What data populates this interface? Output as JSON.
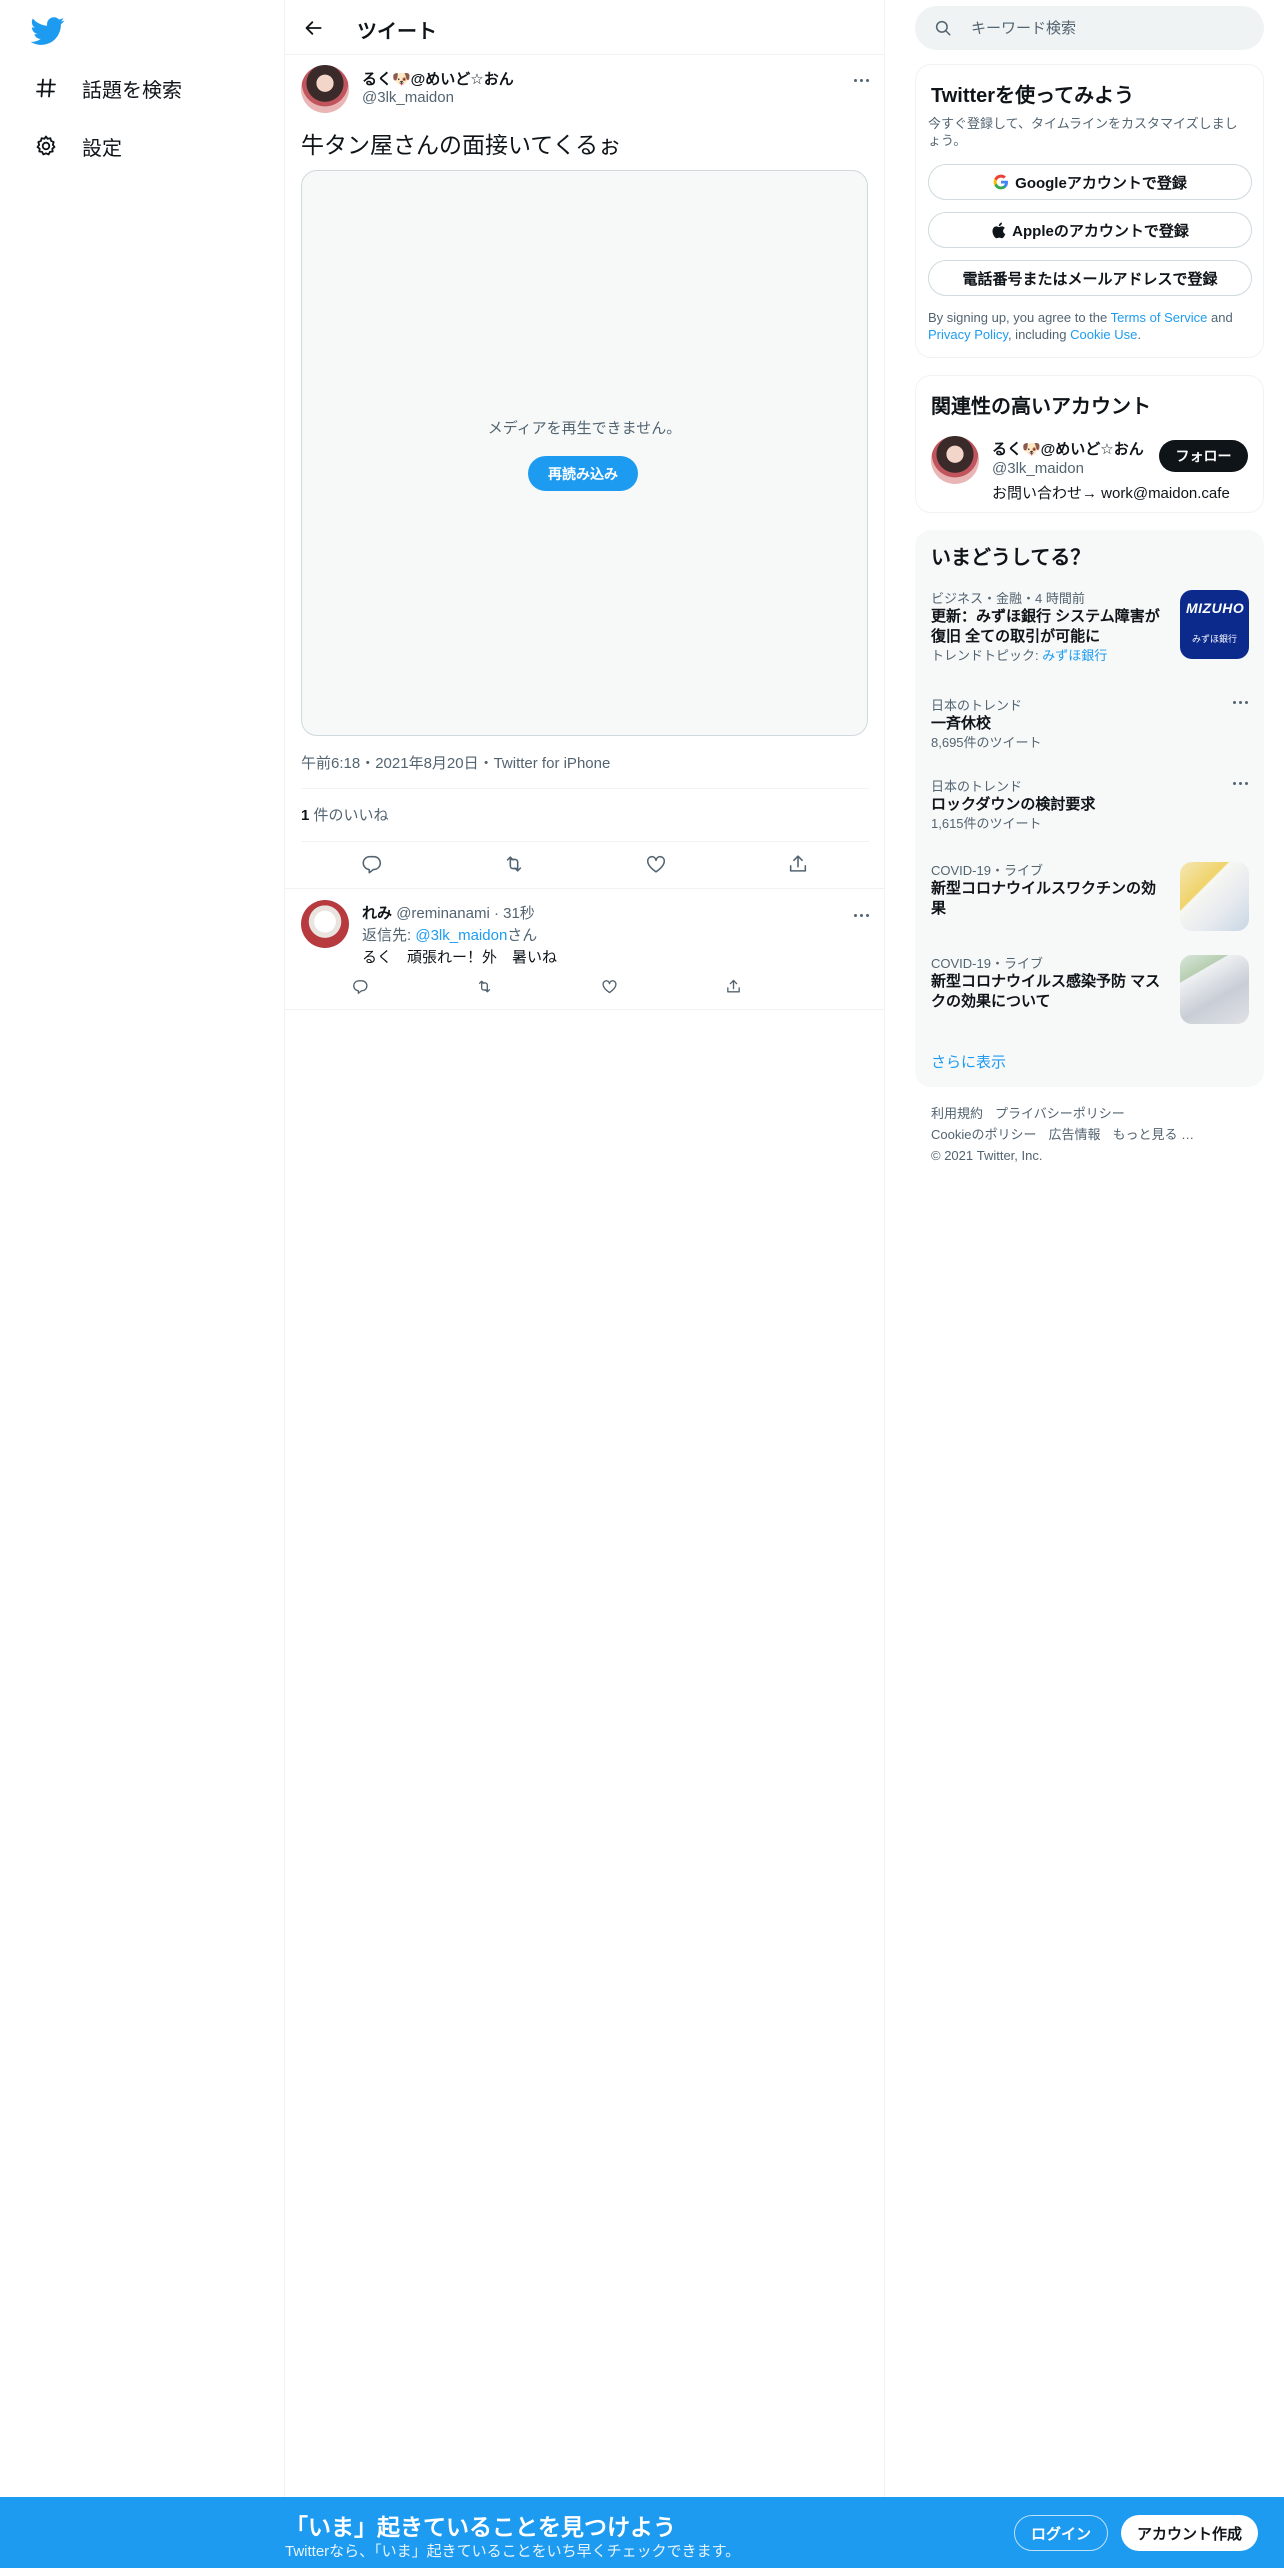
{
  "nav": {
    "logo_icon": "twitter-bird-icon",
    "explore_label": "話題を検索",
    "settings_label": "設定"
  },
  "header": {
    "title": "ツイート"
  },
  "tweet": {
    "author_name": "るく🐶@めいど☆おん",
    "author_handle": "@3lk_maidon",
    "text": "牛タン屋さんの面接いてくるぉ",
    "media_error": "メディアを再生できません。",
    "reload_label": "再読み込み",
    "meta": "午前6:18・2021年8月20日・Twitter for iPhone",
    "likes_count": "1",
    "likes_label": "件のいいね"
  },
  "reply": {
    "author_name": "れみ",
    "author_handle": "@reminanami",
    "time": "31秒",
    "reply_to_prefix": "返信先: ",
    "reply_to_handle": "@3lk_maidon",
    "reply_to_suffix": "さん",
    "text": "るく　頑張れー！外　暑いね"
  },
  "search": {
    "placeholder": "キーワード検索"
  },
  "signup": {
    "title": "Twitterを使ってみよう",
    "subtitle": "今すぐ登録して、タイムラインをカスタマイズしましょう。",
    "google_label": "Googleアカウントで登録",
    "apple_label": "Appleのアカウントで登録",
    "phone_label": "電話番号またはメールアドレスで登録",
    "terms_prefix": "By signing up, you agree to the ",
    "terms_link": "Terms of Service",
    "terms_and": " and ",
    "privacy_link": "Privacy Policy",
    "terms_including": ", including ",
    "cookie_link": "Cookie Use",
    "terms_end": "."
  },
  "who": {
    "title": "関連性の高いアカウント",
    "name": "るく🐶@めいど☆おん",
    "handle": "@3lk_maidon",
    "bio": "お問い合わせ→ work@maidon.cafe",
    "follow_label": "フォロー"
  },
  "trends": {
    "title": "いまどうしてる？",
    "items": [
      {
        "meta": "ビジネス・金融・4 時間前",
        "name": "更新：みずほ銀行 システム障害が復旧 全ての取引が可能に",
        "topic_prefix": "トレンドトピック: ",
        "topic": "みずほ銀行",
        "thumb_text_1": "MIZUHO",
        "thumb_text_2": "みずほ銀行"
      },
      {
        "meta": "日本のトレンド",
        "name": "一斉休校",
        "count": "8,695件のツイート"
      },
      {
        "meta": "日本のトレンド",
        "name": "ロックダウンの検討要求",
        "count": "1,615件のツイート"
      },
      {
        "meta": "COVID-19・ライブ",
        "name": "新型コロナウイルスワクチンの効果"
      },
      {
        "meta": "COVID-19・ライブ",
        "name": "新型コロナウイルス感染予防 マスクの効果について"
      }
    ],
    "show_more": "さらに表示"
  },
  "footer": {
    "terms": "利用規約",
    "privacy": "プライバシーポリシー",
    "cookie": "Cookieのポリシー",
    "ads": "広告情報",
    "more": "もっと見る …",
    "copyright": "© 2021 Twitter, Inc."
  },
  "bottom": {
    "title": "「いま」起きていることを見つけよう",
    "subtitle": "Twitterなら、「いま」起きていることをいち早くチェックできます。",
    "login_label": "ログイン",
    "signup_label": "アカウント作成"
  },
  "colors": {
    "accent": "#1d9bf0",
    "text_primary": "#0f1419",
    "text_secondary": "#536471",
    "border": "#eff3f4"
  }
}
